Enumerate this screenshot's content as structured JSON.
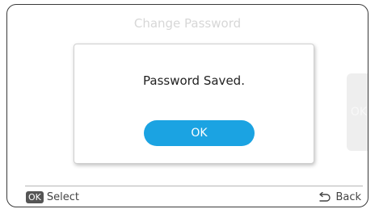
{
  "screen": {
    "title": "Change Password",
    "side_button_label": "OK"
  },
  "dialog": {
    "message": "Password Saved.",
    "ok_label": "OK"
  },
  "footer": {
    "select_badge": "OK",
    "select_label": "Select",
    "back_label": "Back",
    "back_icon": "return-arrow-icon"
  },
  "colors": {
    "accent": "#1ba3e2",
    "border": "#3a3a3a",
    "badge": "#555555"
  }
}
